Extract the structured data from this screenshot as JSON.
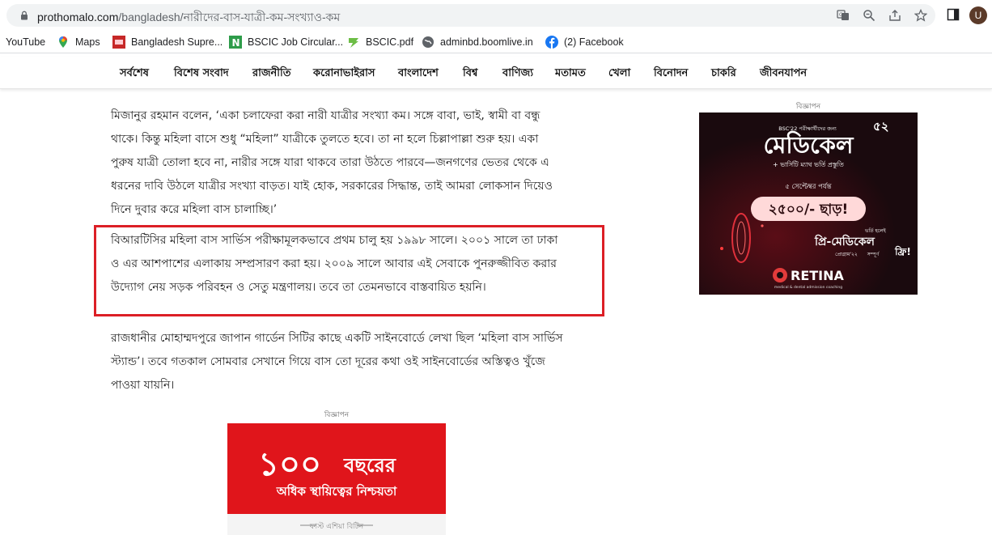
{
  "browser": {
    "url_domain": "prothomalo.com",
    "url_path": "/bangladesh/নারীদের-বাস-যাত্রী-কম-সংখ্যাও-কম",
    "profile_initial": "U"
  },
  "bookmarks": [
    {
      "label": "YouTube",
      "icon": "youtube-icon"
    },
    {
      "label": "Maps",
      "icon": "maps-icon"
    },
    {
      "label": "Bangladesh Supre...",
      "icon": "supreme-court-icon"
    },
    {
      "label": "BSCIC Job Circular...",
      "icon": "bscic-n-icon"
    },
    {
      "label": "BSCIC.pdf",
      "icon": "bscic-pdf-icon"
    },
    {
      "label": "adminbd.boomlive.in",
      "icon": "globe-icon"
    },
    {
      "label": "(2) Facebook",
      "icon": "facebook-icon"
    }
  ],
  "nav": {
    "items": [
      "সর্বশেষ",
      "বিশেষ সংবাদ",
      "রাজনীতি",
      "করোনাভাইরাস",
      "বাংলাদেশ",
      "বিশ্ব",
      "বাণিজ্য",
      "মতামত",
      "খেলা",
      "বিনোদন",
      "চাকরি",
      "জীবনযাপন"
    ]
  },
  "article": {
    "paragraph1": "মিজানুর রহমান বলেন, ‘একা চলাফেরা করা নারী যাত্রীর সংখ্যা কম। সঙ্গে বাবা, ভাই, স্বামী বা বন্ধু থাকে। কিন্তু মহিলা বাসে শুধু “মহিলা” যাত্রীকে তুলতে হবে। তা না হলে চিল্লাপাল্লা শুরু হয়। একা পুরুষ যাত্রী তোলা হবে না, নারীর সঙ্গে যারা থাকবে তারা উঠতে পারবে—জনগণের ভেতর থেকে এ ধরনের দাবি উঠলে যাত্রীর সংখ্যা বাড়ত। যাই হোক, সরকারের সিদ্ধান্ত, তাই আমরা লোকসান দিয়েও দিনে দুবার করে মহিলা বাস চালাচ্ছি।’",
    "paragraph2": "বিআরটিসির মহিলা বাস সার্ভিস পরীক্ষামূলকভাবে প্রথম চালু হয় ১৯৯৮ সালে। ২০০১ সালে তা ঢাকা ও এর আশপাশের এলাকায় সম্প্রসারণ করা হয়। ২০০৯ সালে আবার এই সেবাকে পুনরুজ্জীবিত করার উদ্যোগ নেয় সড়ক পরিবহন ও সেতু মন্ত্রণালয়। তবে তা তেমনভাবে বাস্তবায়িত হয়নি।",
    "paragraph3": "রাজধানীর মোহাম্মদপুরে জাপান গার্ডেন সিটির কাছে একটি সাইনবোর্ডে লেখা ছিল ‘মহিলা বাস সার্ভিস স্ট্যান্ড’। তবে গতকাল সোমবার সেখানে গিয়ে বাস তো দূরের কথা ওই সাইনবোর্ডের অস্তিত্বও খুঁজে পাওয়া যায়নি।"
  },
  "ads": {
    "label": "বিজ্ঞাপন",
    "right": {
      "top_small": "BSC'22 পরীক্ষার্থীদের জন্য",
      "badge": "৫২",
      "title": "মেডিকেল",
      "subtitle": "+ ভার্সিটি ম্যাথ ভর্তি প্রস্তুতি",
      "deadline": "৫ সেপ্টেম্বর পর্যন্ত",
      "discount": "২৫০০/- ছাড়!",
      "pre_small": "ভর্তি হলেই",
      "pre_medical": "প্রি-মেডিকেল",
      "pre_year": "প্রোগ্রাম'২২",
      "free_prefix": "সম্পূর্ণ",
      "free": "ফ্রি!",
      "brand": "RETINA",
      "brand_sub": "medical & dental admission coaching"
    },
    "bottom": {
      "big_number": "১০০",
      "big_text": "বছরের",
      "tagline": "অধিক স্থায়িত্বের নিশ্চয়তা",
      "strip": "ফাস্ট এশিয়া বিটিন"
    }
  },
  "colors": {
    "highlight_border": "#dc1f26",
    "ad_bottom_bg": "#e0151b",
    "ad_right_bg": "#1a0a0e",
    "discount_pill": "#ffd9d9"
  }
}
